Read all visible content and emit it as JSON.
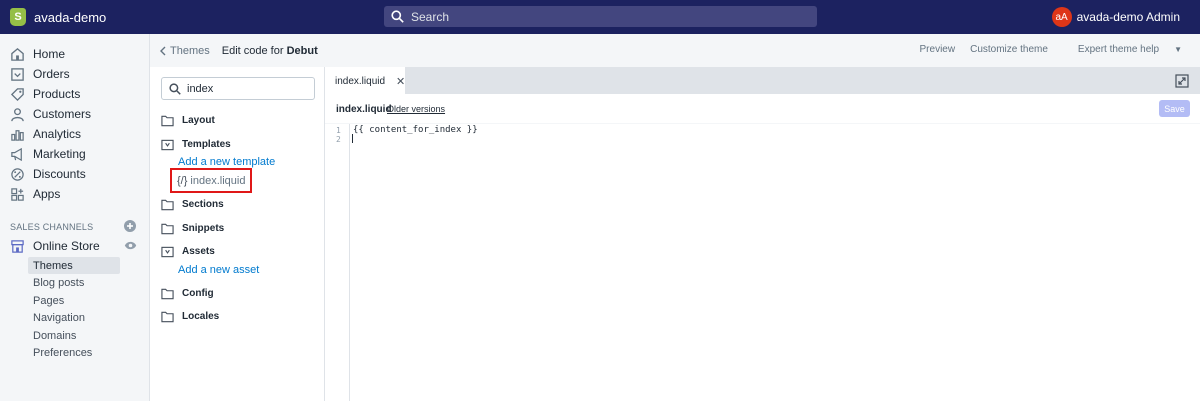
{
  "topbar": {
    "store_name": "avada-demo",
    "search_placeholder": "Search",
    "avatar_initials": "aA",
    "user_name": "avada-demo Admin"
  },
  "nav": {
    "items": [
      {
        "label": "Home",
        "icon": "home-icon"
      },
      {
        "label": "Orders",
        "icon": "orders-icon"
      },
      {
        "label": "Products",
        "icon": "tag-icon"
      },
      {
        "label": "Customers",
        "icon": "person-icon"
      },
      {
        "label": "Analytics",
        "icon": "bar-chart-icon"
      },
      {
        "label": "Marketing",
        "icon": "megaphone-icon"
      },
      {
        "label": "Discounts",
        "icon": "discount-icon"
      },
      {
        "label": "Apps",
        "icon": "apps-icon"
      }
    ],
    "channels_title": "SALES CHANNELS",
    "online_store": "Online Store",
    "sub_items": [
      "Themes",
      "Blog posts",
      "Pages",
      "Navigation",
      "Domains",
      "Preferences"
    ],
    "active_sub_item": "Themes"
  },
  "header": {
    "breadcrumb": "Themes",
    "title_prefix": "Edit code for",
    "theme_name": "Debut",
    "links": [
      "Preview",
      "Customize theme",
      "Expert theme help"
    ]
  },
  "files": {
    "search_value": "index",
    "folders": [
      "Layout",
      "Templates",
      "Sections",
      "Snippets",
      "Assets",
      "Config",
      "Locales"
    ],
    "add_template": "Add a new template",
    "template_file_icon": "{/}",
    "template_file": "index.liquid",
    "add_asset": "Add a new asset"
  },
  "editor": {
    "tab_label": "index.liquid",
    "tab_close": "✕",
    "file_name": "index.liquid",
    "older_versions": "Older versions",
    "save_label": "Save",
    "lines": [
      {
        "num": "1",
        "code": "{{ content_for_index }}"
      },
      {
        "num": "2",
        "code": ""
      }
    ]
  },
  "colors": {
    "topbar": "#1c2260",
    "accent_link": "#007ace",
    "highlight_box": "#e01818",
    "save_disabled": "#b3bcf5"
  }
}
